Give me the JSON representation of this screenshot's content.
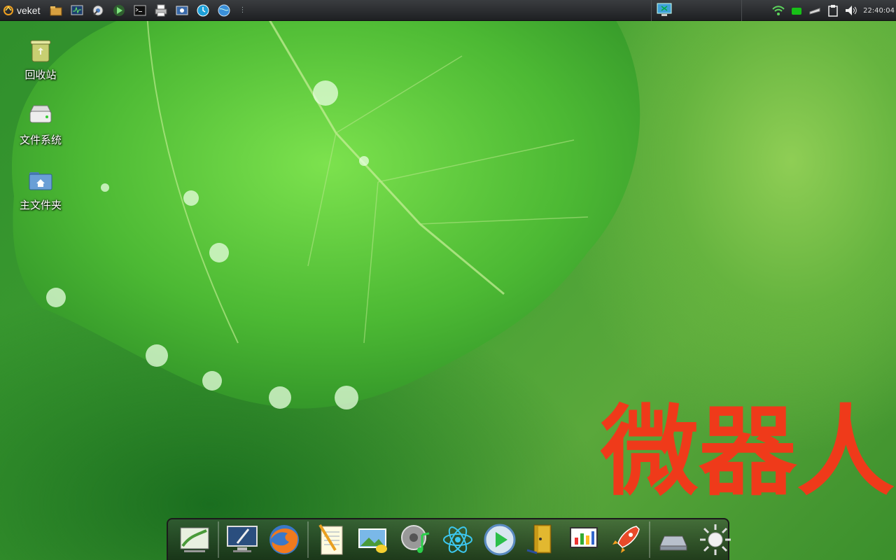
{
  "panel": {
    "menu_label": "veket",
    "clock": "22:40:04",
    "launchers": [
      {
        "icon": "home-folder-icon"
      },
      {
        "icon": "system-monitor-icon"
      },
      {
        "icon": "settings-wizard-icon"
      },
      {
        "icon": "run-icon"
      },
      {
        "icon": "terminal-icon"
      },
      {
        "icon": "printer-icon"
      },
      {
        "icon": "screenshot-icon"
      },
      {
        "icon": "clock-icon"
      },
      {
        "icon": "browser-globe-icon"
      }
    ],
    "separator": "⋮",
    "task_item_icon": "desktop-window-icon",
    "tray": [
      {
        "icon": "wifi-icon"
      },
      {
        "icon": "battery-icon"
      },
      {
        "icon": "network-drive-icon"
      },
      {
        "icon": "clipboard-icon"
      },
      {
        "icon": "volume-icon"
      }
    ]
  },
  "desktop": {
    "icons": [
      {
        "label": "回收站",
        "icon": "trash-icon"
      },
      {
        "label": "文件系统",
        "icon": "drive-icon"
      },
      {
        "label": "主文件夹",
        "icon": "home-folder-icon"
      }
    ],
    "watermark": "微器人"
  },
  "dock": {
    "items": [
      {
        "icon": "desktop-wallpaper-icon"
      },
      {
        "icon": "monitor-settings-icon"
      },
      {
        "icon": "firefox-icon"
      },
      {
        "icon": "text-editor-icon"
      },
      {
        "icon": "image-paint-icon"
      },
      {
        "icon": "music-player-icon"
      },
      {
        "icon": "atom-science-icon"
      },
      {
        "icon": "media-play-icon"
      },
      {
        "icon": "exit-door-icon"
      },
      {
        "icon": "presentation-chart-icon"
      },
      {
        "icon": "rocket-icon"
      },
      {
        "icon": "hard-disk-icon"
      },
      {
        "icon": "brightness-sun-icon"
      }
    ]
  },
  "colors": {
    "watermark": "#ef3a1a",
    "panel_bg": "#2a2c2e"
  }
}
